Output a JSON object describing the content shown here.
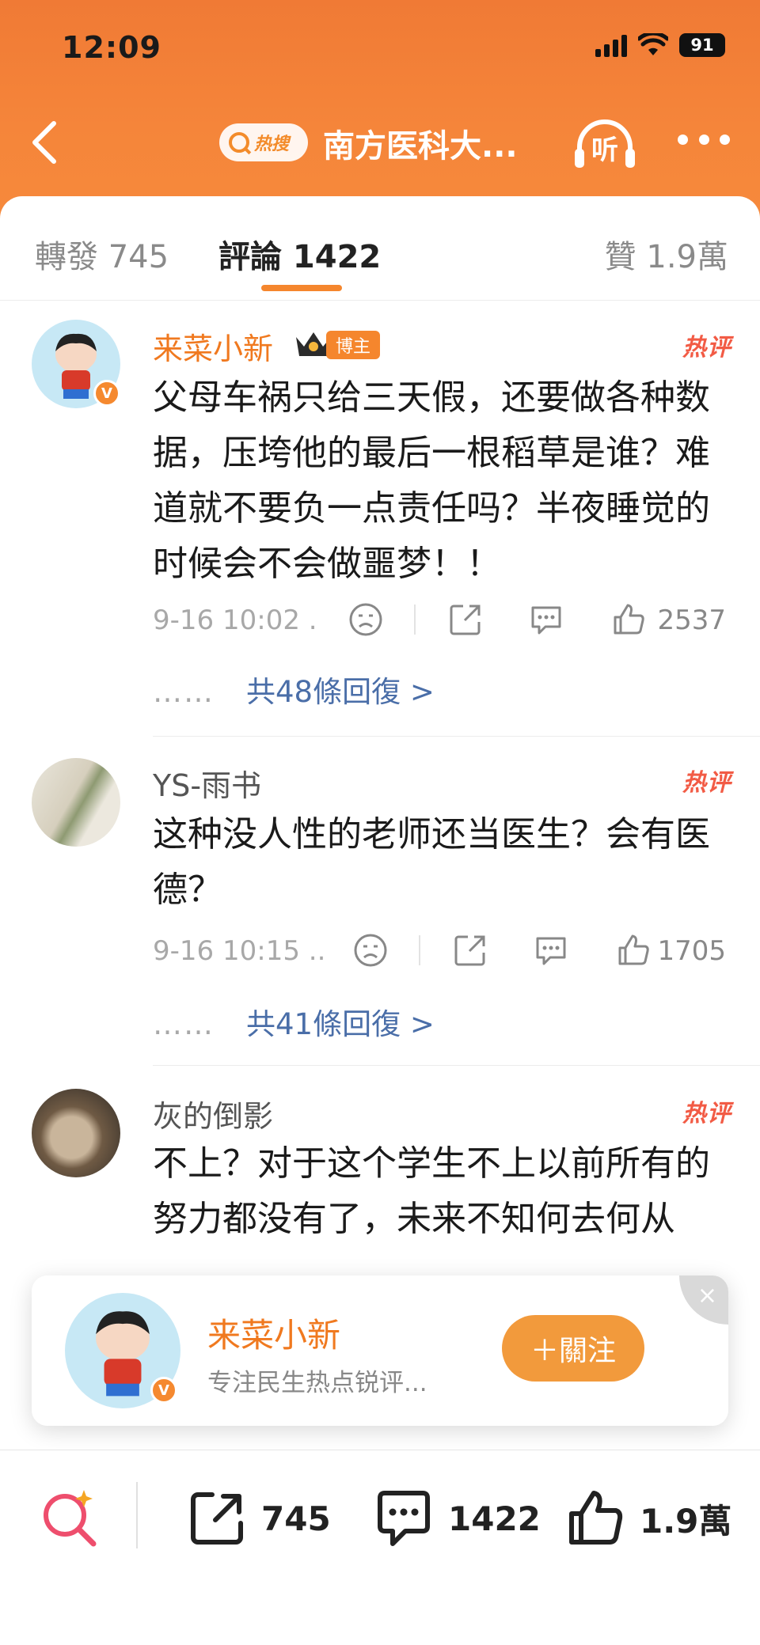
{
  "status_bar": {
    "time": "12:09",
    "battery": "91"
  },
  "nav": {
    "hot_badge": "热搜",
    "title": "南方医科大...",
    "listen_label": "听"
  },
  "tabs": [
    {
      "label": "轉發 745"
    },
    {
      "label": "評論 1422"
    },
    {
      "label": "贊 1.9萬"
    }
  ],
  "comments": [
    {
      "username": "来菜小新",
      "badge": "博主",
      "verified": "V",
      "hot_tag": "热评",
      "text": "父母车祸只给三天假，还要做各种数据，压垮他的最后一根稻草是谁？难道就不要负一点责任吗？半夜睡觉的时候会不会做噩梦！！",
      "time": "9-16 10:02 .",
      "likes": "2537",
      "replies": "共48條回復 >"
    },
    {
      "username": "YS-雨书",
      "hot_tag": "热评",
      "text": "这种没人性的老师还当医生？会有医德？",
      "time": "9-16 10:15 ..",
      "likes": "1705",
      "replies": "共41條回復 >"
    },
    {
      "username": "灰的倒影",
      "hot_tag": "热评",
      "text": "不上？对于这个学生不上以前所有的努力都没有了，未来不知何去何从"
    }
  ],
  "reply_dots": "……",
  "popup": {
    "name": "来菜小新",
    "desc": "专注民生热点锐评...",
    "follow": "＋關注",
    "verified": "V",
    "close": "×"
  },
  "bottom_bar": {
    "reposts": "745",
    "comments": "1422",
    "likes": "1.9萬"
  },
  "colors": {
    "accent": "#f5862d",
    "header": "#f07a35",
    "link": "#4a6ea8",
    "hot": "#f25b45"
  }
}
